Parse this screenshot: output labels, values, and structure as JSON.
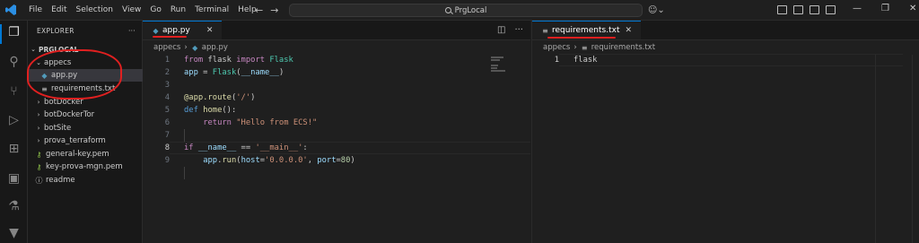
{
  "titlebar": {
    "menu": [
      "File",
      "Edit",
      "Selection",
      "View",
      "Go",
      "Run",
      "Terminal",
      "Help"
    ],
    "search_text": "PrgLocal",
    "icons": [
      "vscode-logo",
      "back-arrow",
      "forward-arrow",
      "search-icon",
      "copilot-icon",
      "layout-icons",
      "minimize",
      "maximize",
      "close"
    ]
  },
  "activitybar": {
    "icons": [
      "explorer-icon",
      "search-icon",
      "source-control-icon",
      "run-debug-icon",
      "extensions-icon",
      "remote-explorer-icon",
      "testing-icon",
      "docker-icon"
    ]
  },
  "explorer": {
    "title": "EXPLORER",
    "more": "···",
    "root": "PRGLOCAL",
    "items": [
      {
        "label": "appecs",
        "kind": "folder-open"
      },
      {
        "label": "app.py",
        "kind": "python"
      },
      {
        "label": "requirements.txt",
        "kind": "text"
      },
      {
        "label": "botDocker",
        "kind": "folder"
      },
      {
        "label": "botDockerTor",
        "kind": "folder"
      },
      {
        "label": "botSite",
        "kind": "folder"
      },
      {
        "label": "prova_terraform",
        "kind": "folder"
      },
      {
        "label": "general-key.pem",
        "kind": "key"
      },
      {
        "label": "key-prova-mgn.pem",
        "kind": "key"
      },
      {
        "label": "readme",
        "kind": "text"
      }
    ]
  },
  "editor_left": {
    "tab_label": "app.py",
    "breadcrumb": [
      "appecs",
      "app.py"
    ],
    "line_numbers": [
      "1",
      "2",
      "3",
      "4",
      "5",
      "6",
      "7",
      "8",
      "9"
    ]
  },
  "editor_right": {
    "tab_label": "requirements.txt",
    "breadcrumb": [
      "appecs",
      "requirements.txt"
    ],
    "line_number": "1",
    "line_text": "flask"
  },
  "colors": {
    "accent": "#0078d4",
    "annotation": "#e02020"
  }
}
